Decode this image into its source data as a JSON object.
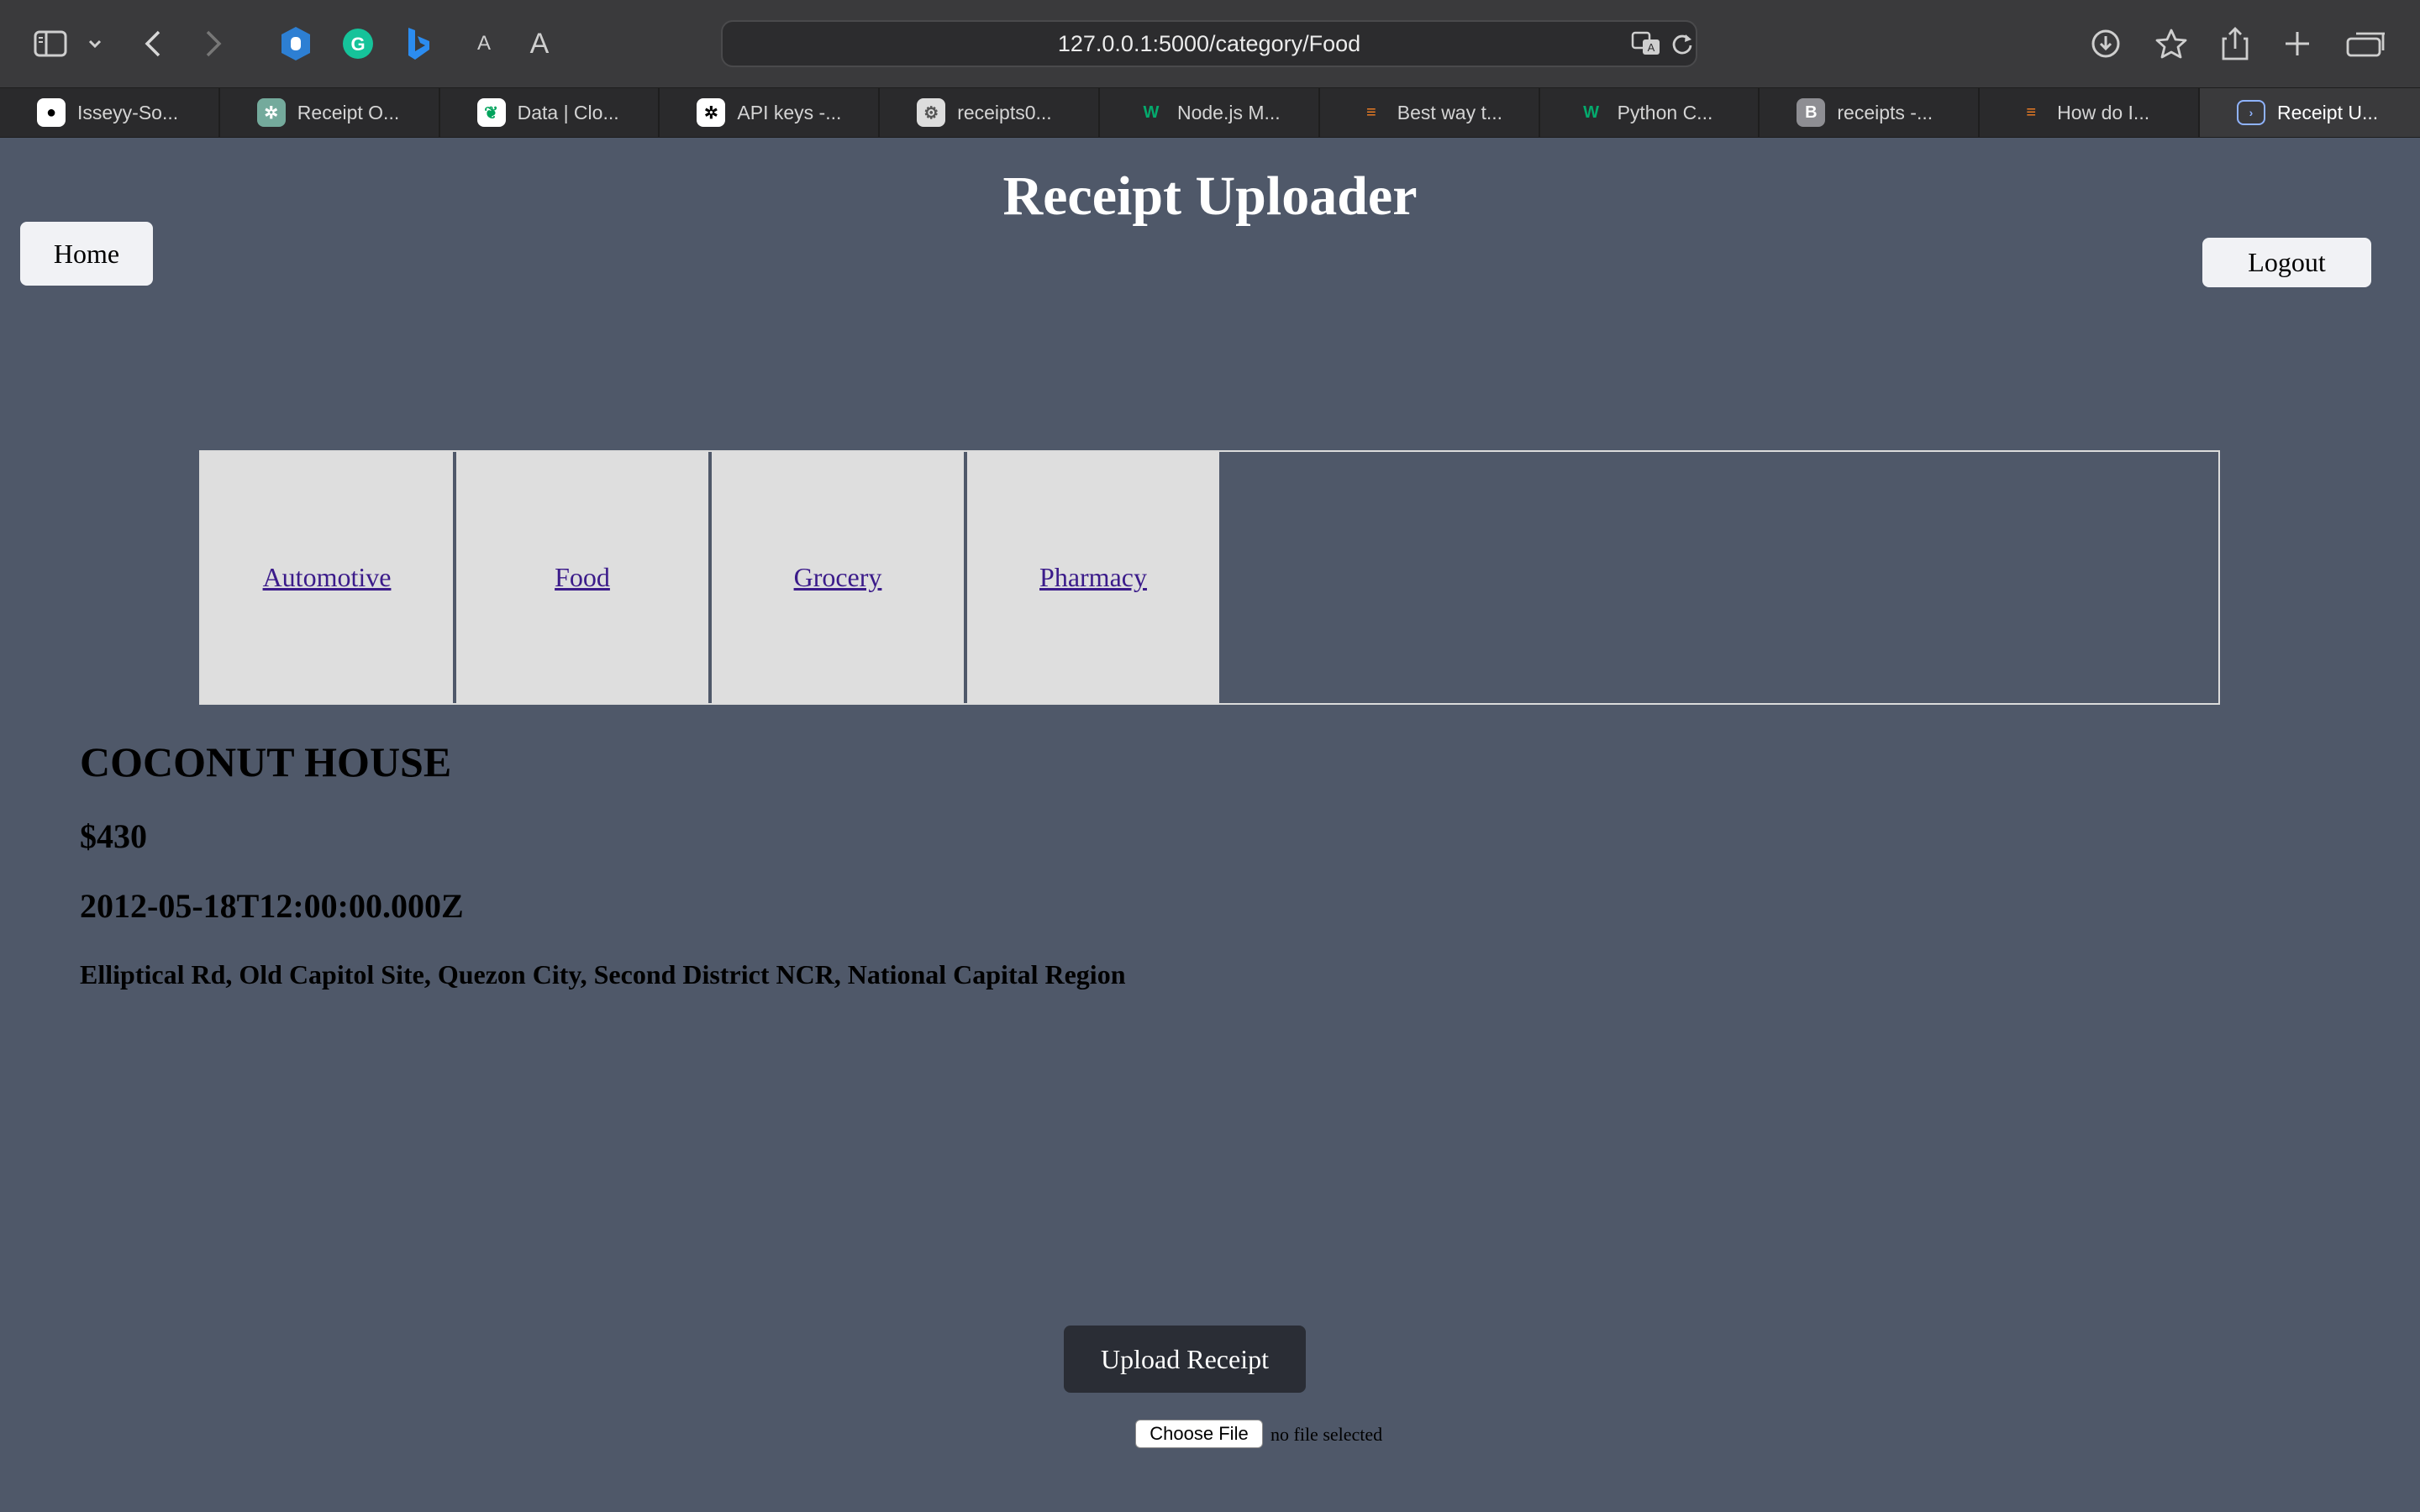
{
  "browser": {
    "url": "127.0.0.1:5000/category/Food",
    "tabs": [
      {
        "label": "Isseyy-So...",
        "color": "#ffffff",
        "letter": ""
      },
      {
        "label": "Receipt O...",
        "color": "#74aa9c",
        "letter": ""
      },
      {
        "label": "Data | Clo...",
        "color": "#00ed64",
        "letter": ""
      },
      {
        "label": "API keys -...",
        "color": "#ffffff",
        "letter": ""
      },
      {
        "label": "receipts0...",
        "color": "#dddddd",
        "letter": ""
      },
      {
        "label": "Node.js M...",
        "color": "#04aa6d",
        "letter": ""
      },
      {
        "label": "Best way t...",
        "color": "#f48024",
        "letter": ""
      },
      {
        "label": "Python C...",
        "color": "#04aa6d",
        "letter": ""
      },
      {
        "label": "receipts -...",
        "color": "#8e8e93",
        "letter": "B"
      },
      {
        "label": "How do I...",
        "color": "#f48024",
        "letter": ""
      },
      {
        "label": "Receipt U...",
        "color": "#8fb3ff",
        "letter": ""
      }
    ]
  },
  "page": {
    "title": "Receipt Uploader",
    "home_label": "Home",
    "logout_label": "Logout",
    "categories": [
      "Automotive",
      "Food",
      "Grocery",
      "Pharmacy"
    ],
    "receipt": {
      "merchant": "COCONUT HOUSE",
      "amount": "$430",
      "date": "2012-05-18T12:00:00.000Z",
      "address": "Elliptical Rd, Old Capitol Site, Quezon City, Second District NCR, National Capital Region"
    },
    "upload_label": "Upload Receipt",
    "choose_file_label": "Choose File",
    "file_status": "no file selected"
  },
  "colors": {
    "page_background": "#4f5869",
    "category_cell": "#dedede",
    "link": "#3b1b8a",
    "upload_button": "#2a2d35"
  }
}
